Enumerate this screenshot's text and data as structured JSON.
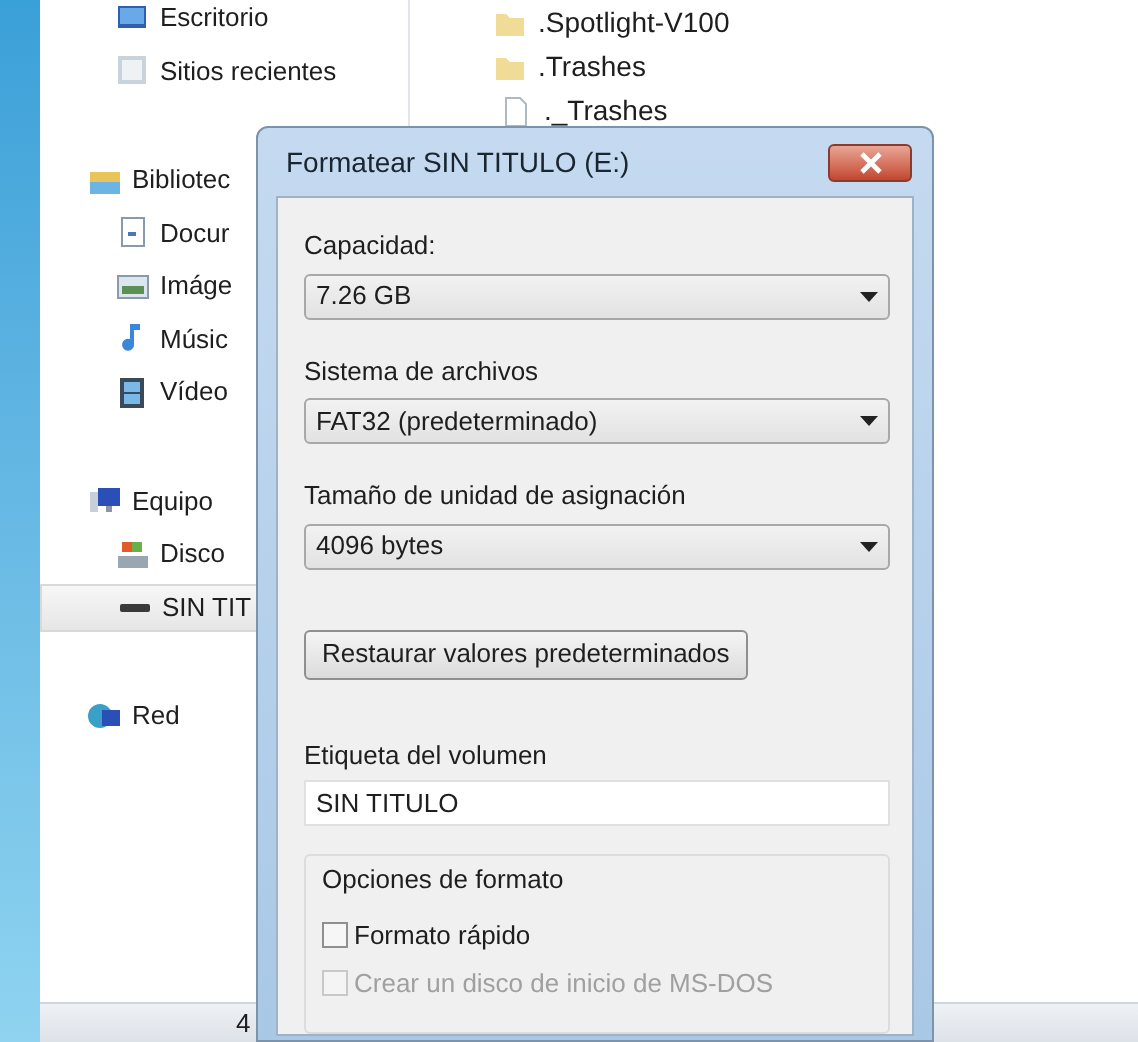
{
  "favorites": [
    {
      "label": "Escritorio",
      "selected": false
    },
    {
      "label": "Sitios recientes",
      "selected": false
    }
  ],
  "navigation": [
    {
      "label": "Bibliotec",
      "selected": false,
      "children": [
        {
          "label": "Docur",
          "selected": false
        },
        {
          "label": "Imáge",
          "selected": false
        },
        {
          "label": "Músic",
          "selected": false
        },
        {
          "label": "Vídeo",
          "selected": false
        }
      ]
    },
    {
      "label": "Equipo",
      "selected": false,
      "children": [
        {
          "label": "Disco",
          "selected": false
        },
        {
          "label": "SIN TIT",
          "selected": true
        }
      ]
    },
    {
      "label": "Red",
      "selected": false
    }
  ],
  "files": [
    {
      "name": ".Spotlight-V100",
      "kind": "folder"
    },
    {
      "name": ".Trashes",
      "kind": "folder"
    },
    {
      "name": "._Trashes",
      "kind": "file"
    }
  ],
  "status_bar": {
    "text": "4"
  },
  "dialog": {
    "title": "Formatear SIN TITULO (E:)",
    "fields": [
      {
        "label": "Capacidad:",
        "value": "7.26 GB"
      },
      {
        "label": "Sistema de archivos",
        "value": "FAT32 (predeterminado)"
      },
      {
        "label": "Tamaño de unidad de asignación",
        "value": "4096 bytes"
      }
    ],
    "restore_button": "Restaurar valores predeterminados",
    "volume_label": {
      "label": "Etiqueta del volumen",
      "value": "SIN TITULO"
    },
    "options": {
      "title": "Opciones de formato",
      "items": [
        {
          "label": "Formato rápido",
          "checked": false,
          "disabled": false
        },
        {
          "label": "Crear un disco de inicio de MS-DOS",
          "checked": false,
          "disabled": true
        }
      ]
    }
  }
}
